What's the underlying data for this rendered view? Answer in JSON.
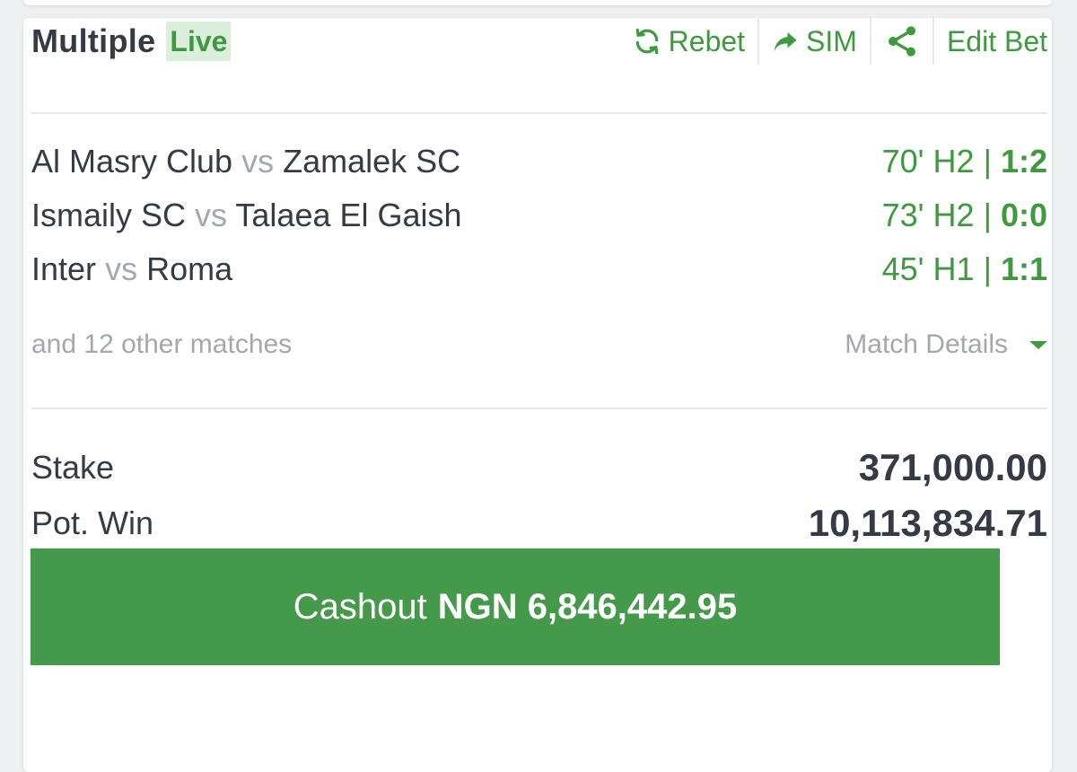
{
  "bet": {
    "type": "Multiple",
    "live_label": "Live"
  },
  "actions": {
    "rebet": "Rebet",
    "sim": "SIM",
    "edit_bet": "Edit Bet"
  },
  "matches": [
    {
      "home": "Al Masry Club",
      "vs": "vs",
      "away": "Zamalek SC",
      "minute": "70' H2",
      "sep": "|",
      "score": "1:2"
    },
    {
      "home": "Ismaily SC",
      "vs": "vs",
      "away": "Talaea El Gaish",
      "minute": "73' H2",
      "sep": "|",
      "score": "0:0"
    },
    {
      "home": "Inter",
      "vs": "vs",
      "away": "Roma",
      "minute": "45' H1",
      "sep": "|",
      "score": "1:1"
    }
  ],
  "other_matches_text": "and 12 other matches",
  "match_details_label": "Match Details",
  "summary": {
    "stake_label": "Stake",
    "stake_value": "371,000.00",
    "potwin_label": "Pot. Win",
    "potwin_value": "10,113,834.71"
  },
  "cashout": {
    "label": "Cashout",
    "amount": "NGN 6,846,442.95"
  },
  "colors": {
    "accent_green": "#3f9a3f",
    "cashout_bg": "#44994a",
    "text_dark": "#353a45",
    "text_muted": "#a3a8b0"
  },
  "icons": {
    "rebet": "refresh-icon",
    "sim": "share-arrow-icon",
    "share": "share-nodes-icon",
    "details": "caret-down-icon"
  }
}
